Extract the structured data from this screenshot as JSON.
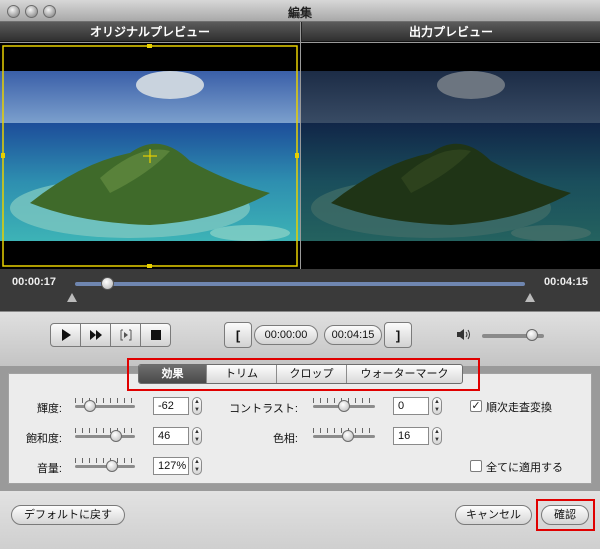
{
  "window": {
    "title": "編集"
  },
  "preview": {
    "original_label": "オリジナルプレビュー",
    "output_label": "出力プレビュー"
  },
  "timeline": {
    "current_time": "00:00:17",
    "end_time": "00:04:15",
    "position": 0.07
  },
  "transport": {
    "play_icon": "play-icon",
    "fast_forward_icon": "fast-forward-icon",
    "frame_icon": "frame-step-icon",
    "stop_icon": "stop-icon",
    "mark_in_glyph": "[",
    "mark_out_glyph": "]",
    "start_time": "00:00:00",
    "end_time": "00:04:15",
    "volume_icon": "speaker-icon",
    "volume_level": 0.8
  },
  "tabs": [
    {
      "label": "効果",
      "active": true
    },
    {
      "label": "トリム",
      "active": false
    },
    {
      "label": "クロップ",
      "active": false
    },
    {
      "label": "ウォーターマーク",
      "active": false
    }
  ],
  "effects": {
    "brightness": {
      "label": "輝度:",
      "value": "-62",
      "level": 0.19
    },
    "saturation": {
      "label": "飽和度:",
      "value": "46",
      "level": 0.73
    },
    "volume": {
      "label": "音量:",
      "value": "127%",
      "level": 0.64
    },
    "contrast": {
      "label": "コントラスト:",
      "value": "0",
      "level": 0.5
    },
    "hue": {
      "label": "色相:",
      "value": "16",
      "level": 0.58
    },
    "deinterlace": {
      "label": "順次走査変換",
      "checked": true
    },
    "apply_all": {
      "label": "全てに適用する",
      "checked": false
    }
  },
  "buttons": {
    "reset": "デフォルトに戻す",
    "cancel": "キャンセル",
    "confirm": "確認"
  },
  "colors": {
    "highlight": "#e00000",
    "crop_frame": "#e8d000"
  }
}
